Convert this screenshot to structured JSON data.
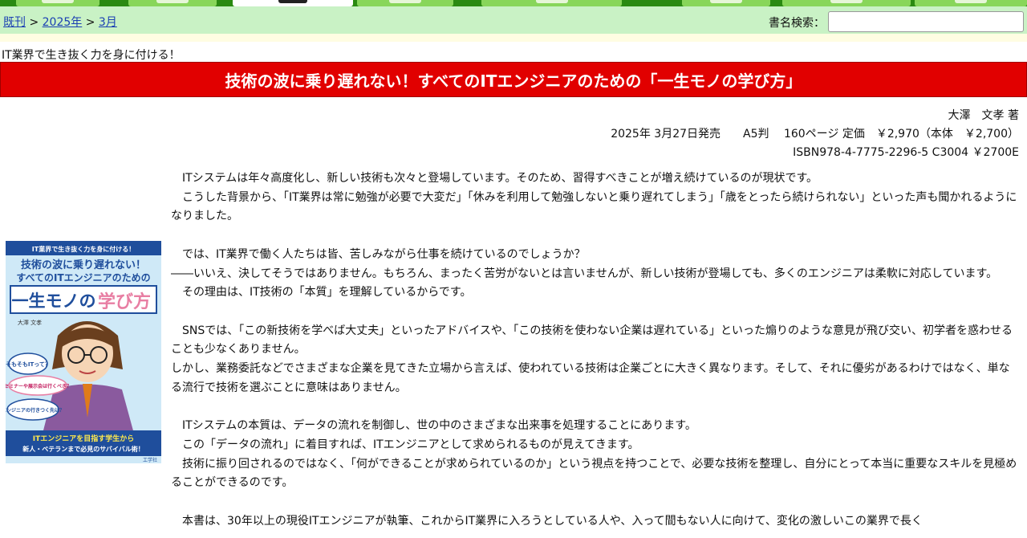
{
  "nav": {
    "breadcrumb": {
      "root": "既刊",
      "sep1": " > ",
      "year": "2025年",
      "sep2": " > ",
      "month": "3月"
    },
    "search_label": "書名検索：",
    "search_placeholder": ""
  },
  "tagline": "IT業界で生き抜く力を身に付ける！",
  "book": {
    "title": "技術の波に乗り遅れない！すべてのITエンジニアのための「一生モノの学び方」",
    "author": "大澤　文孝 著",
    "pubinfo": "2025年 3月27日発売　　A5判　 160ページ 定価　￥2,970（本体　￥2,700）",
    "isbn": "ISBN978-4-7775-2296-5 C3004 ￥2700E"
  },
  "cover": {
    "top_tag": "IT業界で生き抜く力を身に付ける！",
    "title_line1": "技術の波に乗り遅れない！",
    "title_line2": "すべてのITエンジニアのための",
    "title_big1": "一生モノの",
    "title_big2": "学び方",
    "author": "大澤 文孝",
    "bubble1": "そもそもITって？",
    "bubble2": "セミナーや展示会は行くべき？",
    "bubble3": "エンジニアの行きつく先は？",
    "bottom1": "ITエンジニアを目指す学生から",
    "bottom2": "新人・ベテランまで必見のサバイバル術！",
    "publisher": "工学社"
  },
  "body": [
    "　ITシステムは年々高度化し、新しい技術も次々と登場しています。そのため、習得すべきことが増え続けているのが現状です。",
    "　こうした背景から、「IT業界は常に勉強が必要で大変だ」「休みを利用して勉強しないと乗り遅れてしまう」「歳をとったら続けられない」といった声も聞かれるようになりました。",
    "",
    "　では、IT業界で働く人たちは皆、苦しみながら仕事を続けているのでしょうか？",
    "――いいえ、決してそうではありません。もちろん、まったく苦労がないとは言いませんが、新しい技術が登場しても、多くのエンジニアは柔軟に対応しています。",
    "　その理由は、IT技術の「本質」を理解しているからです。",
    "",
    "　SNSでは、「この新技術を学べば大丈夫」といったアドバイスや、「この技術を使わない企業は遅れている」といった煽りのような意見が飛び交い、初学者を惑わせることも少なくありません。",
    "しかし、業務委託などでさまざまな企業を見てきた立場から言えば、使われている技術は企業ごとに大きく異なります。そして、それに優劣があるわけではなく、単なる流行で技術を選ぶことに意味はありません。",
    "",
    "　ITシステムの本質は、データの流れを制御し、世の中のさまざまな出来事を処理することにあります。",
    "　この「データの流れ」に着目すれば、ITエンジニアとして求められるものが見えてきます。",
    "　技術に振り回されるのではなく、「何ができることが求められているのか」という視点を持つことで、必要な技術を整理し、自分にとって本当に重要なスキルを見極めることができるのです。",
    "",
    "　本書は、30年以上の現役ITエンジニアが執筆、これからIT業界に入ろうとしている人や、入って間もない人に向けて、変化の激しいこの業界で長く"
  ]
}
